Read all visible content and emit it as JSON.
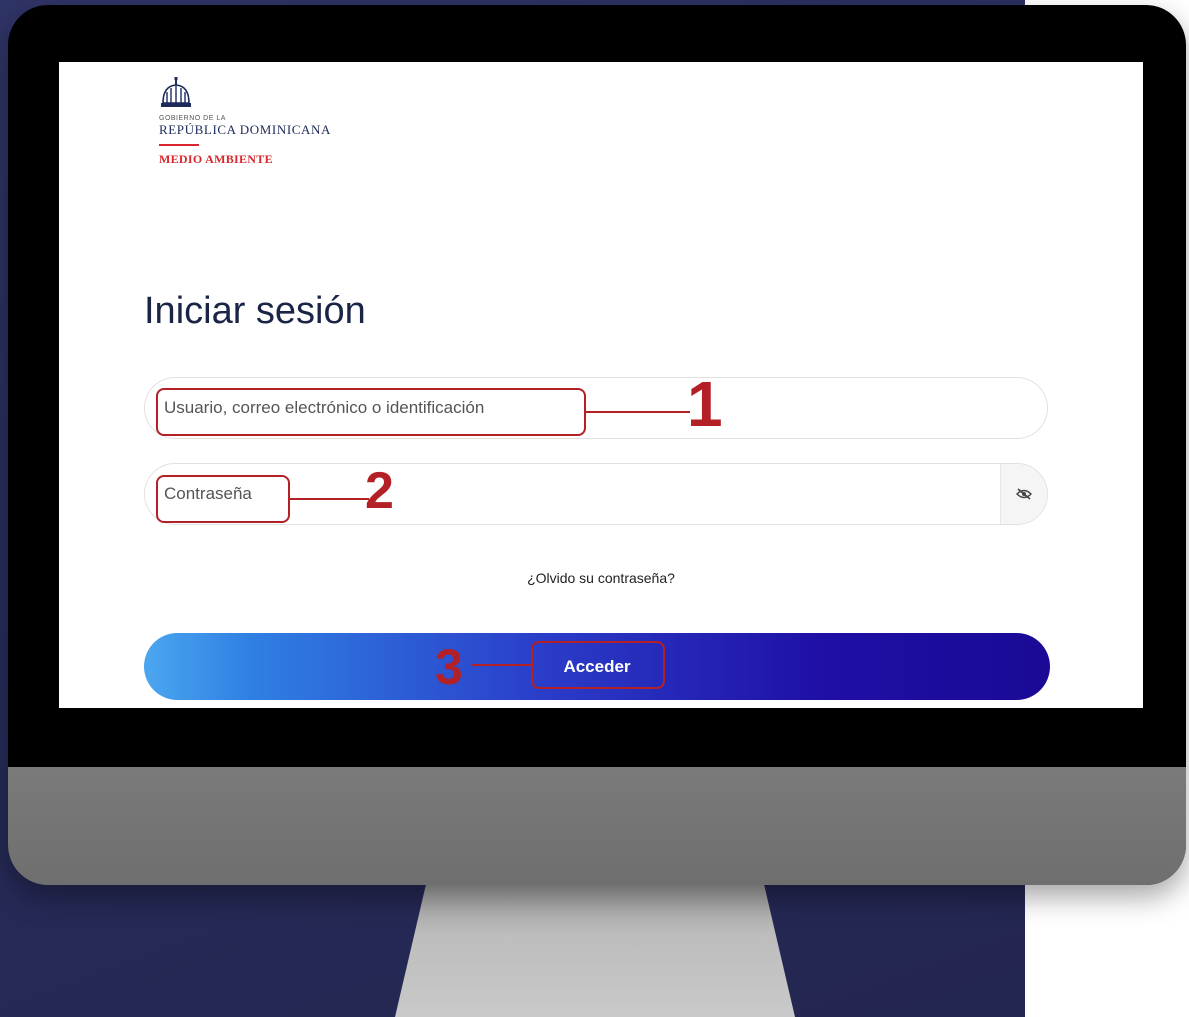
{
  "logo": {
    "line_small": "GOBIERNO DE LA",
    "line_main": "REPÚBLICA DOMINICANA",
    "line_sub": "MEDIO AMBIENTE"
  },
  "login": {
    "title": "Iniciar sesión",
    "username_placeholder": "Usuario, correo electrónico o identificación",
    "password_placeholder": "Contraseña",
    "forgot_link": "¿Olvido su contraseña?",
    "submit_label": "Acceder"
  },
  "annotations": {
    "step1": "1",
    "step2": "2",
    "step3": "3"
  },
  "colors": {
    "annotation": "#b32026",
    "title": "#1a2447",
    "brand_red": "#d9262c"
  }
}
